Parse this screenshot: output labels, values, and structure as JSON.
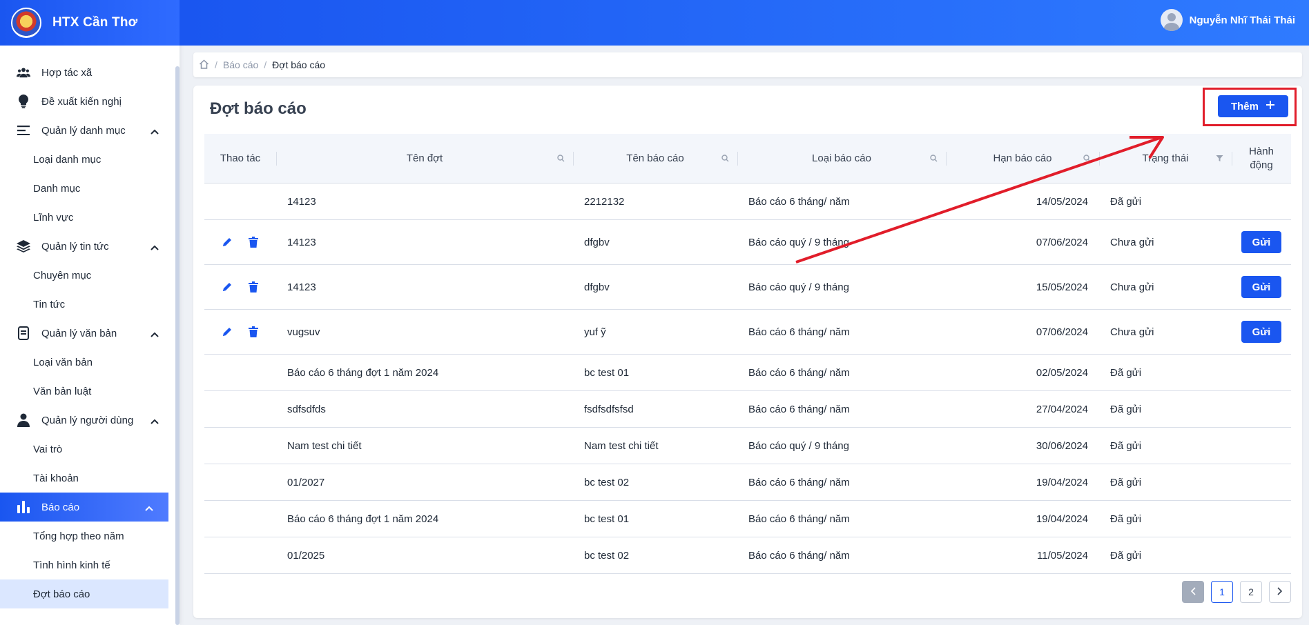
{
  "app": {
    "brand": "HTX Cần Thơ"
  },
  "user": {
    "name": "Nguyễn Nhĩ Thái Thái"
  },
  "sidebar": {
    "items": [
      {
        "label": "Hợp tác xã",
        "icon": "users-icon"
      },
      {
        "label": "Đề xuất kiến nghị",
        "icon": "lightbulb-icon"
      },
      {
        "label": "Quản lý danh mục",
        "icon": "menu-icon"
      },
      {
        "label": "Loại danh mục"
      },
      {
        "label": "Danh mục"
      },
      {
        "label": "Lĩnh vực"
      },
      {
        "label": "Quản lý tin tức",
        "icon": "layers-icon"
      },
      {
        "label": "Chuyên mục"
      },
      {
        "label": "Tin tức"
      },
      {
        "label": "Quản lý văn bản",
        "icon": "document-icon"
      },
      {
        "label": "Loại văn bản"
      },
      {
        "label": "Văn bản luật"
      },
      {
        "label": "Quản lý người dùng",
        "icon": "user-icon"
      },
      {
        "label": "Vai trò"
      },
      {
        "label": "Tài khoản"
      },
      {
        "label": "Báo cáo",
        "icon": "bar-chart-icon"
      },
      {
        "label": "Tổng hợp theo năm"
      },
      {
        "label": "Tình hình kinh tế"
      },
      {
        "label": "Đợt báo cáo"
      }
    ]
  },
  "breadcrumb": {
    "parent": "Báo cáo",
    "current": "Đợt báo cáo"
  },
  "page": {
    "title": "Đợt báo cáo",
    "add_label": "Thêm"
  },
  "table": {
    "headers": [
      "Thao tác",
      "Tên đợt",
      "Tên báo cáo",
      "Loại báo cáo",
      "Hạn báo cáo",
      "Trạng thái",
      "Hành động"
    ],
    "send_label": "Gửi",
    "rows": [
      {
        "ten_dot": "14123",
        "ten_bao_cao": "2212132",
        "loai": "Báo cáo 6 tháng/ năm",
        "han": "14/05/2024",
        "trang_thai": "Đã gửi",
        "editable": false
      },
      {
        "ten_dot": "14123",
        "ten_bao_cao": "dfgbv",
        "loai": "Báo cáo quý / 9 tháng",
        "han": "07/06/2024",
        "trang_thai": "Chưa gửi",
        "editable": true
      },
      {
        "ten_dot": "14123",
        "ten_bao_cao": "dfgbv",
        "loai": "Báo cáo quý / 9 tháng",
        "han": "15/05/2024",
        "trang_thai": "Chưa gửi",
        "editable": true
      },
      {
        "ten_dot": "vugsuv",
        "ten_bao_cao": "yuf ỹ",
        "loai": "Báo cáo 6 tháng/ năm",
        "han": "07/06/2024",
        "trang_thai": "Chưa gửi",
        "editable": true
      },
      {
        "ten_dot": "Báo cáo 6 tháng đợt 1 năm 2024",
        "ten_bao_cao": "bc test 01",
        "loai": "Báo cáo 6 tháng/ năm",
        "han": "02/05/2024",
        "trang_thai": "Đã gửi",
        "editable": false
      },
      {
        "ten_dot": "sdfsdfds",
        "ten_bao_cao": "fsdfsdfsfsd",
        "loai": "Báo cáo 6 tháng/ năm",
        "han": "27/04/2024",
        "trang_thai": "Đã gửi",
        "editable": false
      },
      {
        "ten_dot": "Nam test chi tiết",
        "ten_bao_cao": "Nam test chi tiết",
        "loai": "Báo cáo quý / 9 tháng",
        "han": "30/06/2024",
        "trang_thai": "Đã gửi",
        "editable": false
      },
      {
        "ten_dot": "01/2027",
        "ten_bao_cao": "bc test 02",
        "loai": "Báo cáo 6 tháng/ năm",
        "han": "19/04/2024",
        "trang_thai": "Đã gửi",
        "editable": false
      },
      {
        "ten_dot": "Báo cáo 6 tháng đợt 1 năm 2024",
        "ten_bao_cao": "bc test 01",
        "loai": "Báo cáo 6 tháng/ năm",
        "han": "19/04/2024",
        "trang_thai": "Đã gửi",
        "editable": false
      },
      {
        "ten_dot": "01/2025",
        "ten_bao_cao": "bc test 02",
        "loai": "Báo cáo 6 tháng/ năm",
        "han": "11/05/2024",
        "trang_thai": "Đã gửi",
        "editable": false
      }
    ]
  },
  "pagination": {
    "pages": [
      "1",
      "2"
    ],
    "current": "1"
  },
  "colors": {
    "primary": "#1a56f0",
    "highlight": "#e11d2a"
  }
}
